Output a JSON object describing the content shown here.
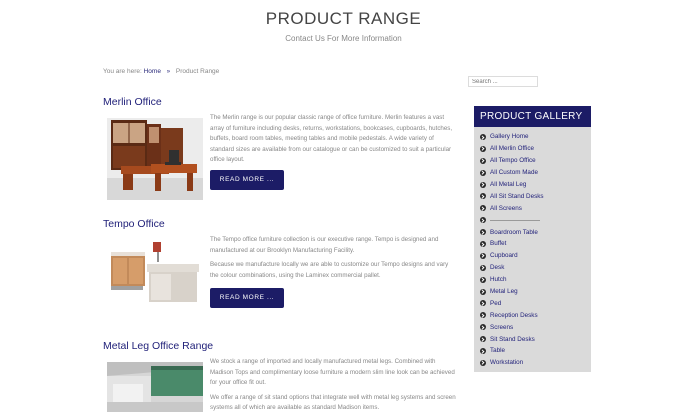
{
  "header": {
    "title": "PRODUCT RANGE",
    "subtitle": "Contact Us For More Information"
  },
  "breadcrumb": {
    "prefix": "You are here:",
    "home": "Home",
    "separator": "»",
    "current": "Product Range"
  },
  "search": {
    "placeholder": "Search ..."
  },
  "products": [
    {
      "title": "Merlin Office",
      "paragraphs": [
        "The Merlin range is our popular classic range of office furniture. Merlin features a vast array of furniture including desks, returns, workstations, bookcases, cupboards, hutches, buffets, board room tables, meeting tables and mobile pedestals. A wide variety of standard sizes are available from our catalogue or can be customized to suit a particular office layout."
      ],
      "button": "READ MORE ..."
    },
    {
      "title": "Tempo Office",
      "paragraphs": [
        "The Tempo office furniture collection is our executive range. Tempo is designed and manufactured at our Brooklyn Manufacturing Facility.",
        "Because we manufacture locally we are able to customize our Tempo designs and vary the colour combinations, using the Laminex commercial pallet."
      ],
      "button": "READ MORE ..."
    },
    {
      "title": "Metal Leg Office Range",
      "paragraphs": [
        "We stock a range of imported and locally manufactured metal legs. Combined with Madison Tops and complimentary loose furniture a modern slim line look can be achieved for your office fit out.",
        "We offer a range of sit stand options that integrate well with metal leg systems and screen systems all of which are available as standard Madison items."
      ]
    }
  ],
  "sidebar": {
    "title": "PRODUCT GALLERY",
    "items": [
      "Gallery Home",
      "All Merlin Office",
      "All Tempo Office",
      "All Custom Made",
      "All Metal Leg",
      "All Sit Stand Desks",
      "All Screens",
      "",
      "Boardroom Table",
      "Buffet",
      "Cupboard",
      "Desk",
      "Hutch",
      "Metal Leg",
      "Ped",
      "Reception Desks",
      "Screens",
      "Sit Stand Desks",
      "Table",
      "Workstation"
    ]
  },
  "colors": {
    "brand": "#1c1c66",
    "link": "#22227a",
    "sidebar_bg": "#dadada"
  }
}
